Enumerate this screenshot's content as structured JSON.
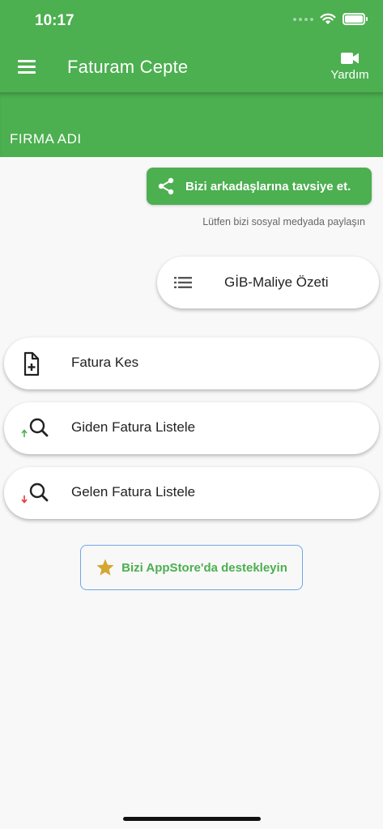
{
  "status_bar": {
    "time": "10:17"
  },
  "app_bar": {
    "title": "Faturam Cepte",
    "help_label": "Yardım"
  },
  "firm": {
    "name": "FIRMA ADI"
  },
  "share": {
    "label": "Bizi arkadaşlarına tavsiye et.",
    "hint": "Lütfen bizi sosyal medyada paylaşın"
  },
  "gib": {
    "label": "GİB-Maliye Özeti"
  },
  "menu": {
    "items": [
      {
        "label": "Fatura Kes",
        "icon": "add-document-icon"
      },
      {
        "label": "Giden Fatura Listele",
        "icon": "search-outgoing-icon"
      },
      {
        "label": "Gelen Fatura Listele",
        "icon": "search-incoming-icon"
      }
    ]
  },
  "support": {
    "label": "Bizi AppStore'da destekleyin"
  },
  "colors": {
    "primary": "#4caf50",
    "star": "#d4a830",
    "outgoing_arrow": "#4caf50",
    "incoming_arrow": "#e53935",
    "support_border": "#6fa8e6"
  }
}
